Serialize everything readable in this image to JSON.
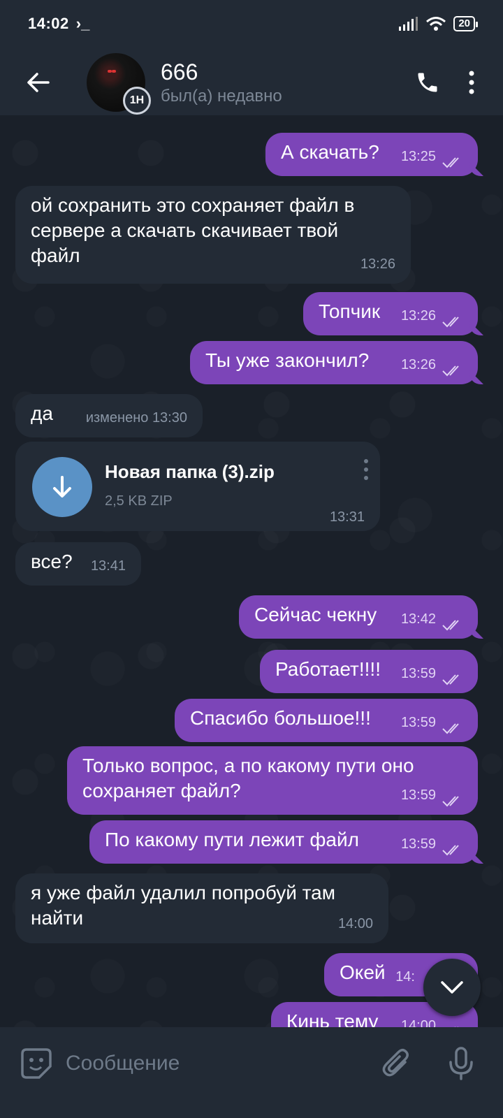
{
  "status_bar": {
    "time": "14:02",
    "prompt": "›_",
    "battery": "20"
  },
  "header": {
    "contact_name": "666",
    "contact_status": "был(а) недавно",
    "story_badge": "1H",
    "icons": {
      "back": "arrow-left-icon",
      "call": "phone-icon",
      "menu": "more-vertical-icon"
    }
  },
  "messages": [
    {
      "dir": "out",
      "text": "А скачать?",
      "time": "13:25"
    },
    {
      "dir": "in",
      "text": "ой сохранить это сохраняет файл в сервере а скачать скачивает твой файл",
      "time": "13:26"
    },
    {
      "dir": "out",
      "text": "Топчик",
      "time": "13:26"
    },
    {
      "dir": "out",
      "text": "Ты уже закончил?",
      "time": "13:26"
    },
    {
      "dir": "in",
      "text": "да",
      "edited": "изменено",
      "time": "13:30"
    },
    {
      "dir": "in",
      "type": "file",
      "file_name": "Новая папка (3).zip",
      "file_size": "2,5 KB ZIP",
      "time": "13:31"
    },
    {
      "dir": "in",
      "text": "все?",
      "time": "13:41"
    },
    {
      "dir": "out",
      "text": "Сейчас чекну",
      "time": "13:42"
    },
    {
      "dir": "out",
      "text": "Работает!!!!",
      "time": "13:59"
    },
    {
      "dir": "out",
      "text": "Спасибо большое!!!",
      "time": "13:59"
    },
    {
      "dir": "out",
      "text": "Только вопрос, а по какому пути оно сохраняет файл?",
      "time": "13:59"
    },
    {
      "dir": "out",
      "text": "По какому пути лежит файл",
      "time": "13:59"
    },
    {
      "dir": "in",
      "text": "я уже файл удалил попробуй там найти",
      "time": "14:00"
    },
    {
      "dir": "out",
      "text": "Окей",
      "time": "14:"
    },
    {
      "dir": "out",
      "text": "Кинь тему",
      "time": "14:00"
    }
  ],
  "input": {
    "placeholder": "Сообщение",
    "icons": {
      "sticker": "sticker-icon",
      "attach": "paperclip-icon",
      "mic": "microphone-icon"
    }
  },
  "fab": {
    "icon": "chevron-down-icon"
  },
  "colors": {
    "outgoing": "#7c45b8",
    "incoming": "#232b36",
    "header": "#222a35",
    "file_button": "#5a92c6"
  }
}
